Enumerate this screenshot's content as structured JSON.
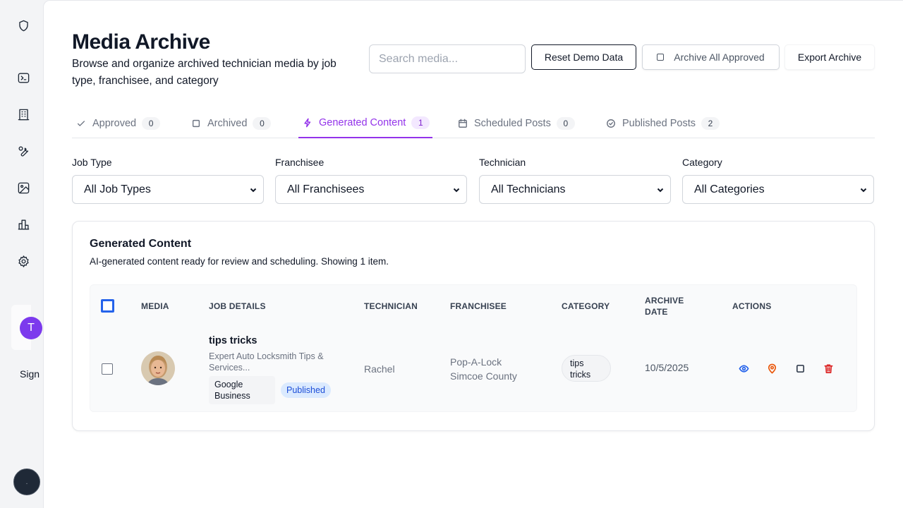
{
  "header": {
    "title": "Media Archive",
    "subtitle": "Browse and organize archived technician media by job type, franchisee, and category"
  },
  "search": {
    "placeholder": "Search media...",
    "value": ""
  },
  "toolbar": {
    "reset_label": "Reset Demo Data",
    "archive_all_label": "Archive All Approved",
    "export_label": "Export Archive"
  },
  "tabs": [
    {
      "label": "Approved",
      "count": "0",
      "icon": "check-icon",
      "active": false
    },
    {
      "label": "Archived",
      "count": "0",
      "icon": "square-icon",
      "active": false
    },
    {
      "label": "Generated Content",
      "count": "1",
      "icon": "lightning-icon",
      "active": true
    },
    {
      "label": "Scheduled Posts",
      "count": "0",
      "icon": "calendar-icon",
      "active": false
    },
    {
      "label": "Published Posts",
      "count": "2",
      "icon": "check-circle-icon",
      "active": false
    }
  ],
  "filters": [
    {
      "label": "Job Type",
      "value": "All Job Types"
    },
    {
      "label": "Franchisee",
      "value": "All Franchisees"
    },
    {
      "label": "Technician",
      "value": "All Technicians"
    },
    {
      "label": "Category",
      "value": "All Categories"
    }
  ],
  "section": {
    "title": "Generated Content",
    "description": "AI-generated content ready for review and scheduling. Showing 1 item."
  },
  "table": {
    "columns": [
      "MEDIA",
      "JOB DETAILS",
      "TECHNICIAN",
      "FRANCHISEE",
      "CATEGORY",
      "ARCHIVE DATE",
      "ACTIONS"
    ],
    "rows": [
      {
        "job_title": "tips tricks",
        "job_desc": "Expert Auto Locksmith Tips & Services...",
        "platform": "Google Business",
        "status": "Published",
        "technician": "Rachel",
        "franchisee": "Pop-A-Lock Simcoe County",
        "category": "tips tricks",
        "archive_date": "10/5/2025"
      }
    ]
  },
  "sidebar": {
    "avatar_initial": "T",
    "sign_label": "Sign"
  },
  "colors": {
    "accent": "#9333ea",
    "view": "#2563eb",
    "location": "#ea580c",
    "delete": "#dc2626",
    "avatar": "#7c3aed"
  }
}
